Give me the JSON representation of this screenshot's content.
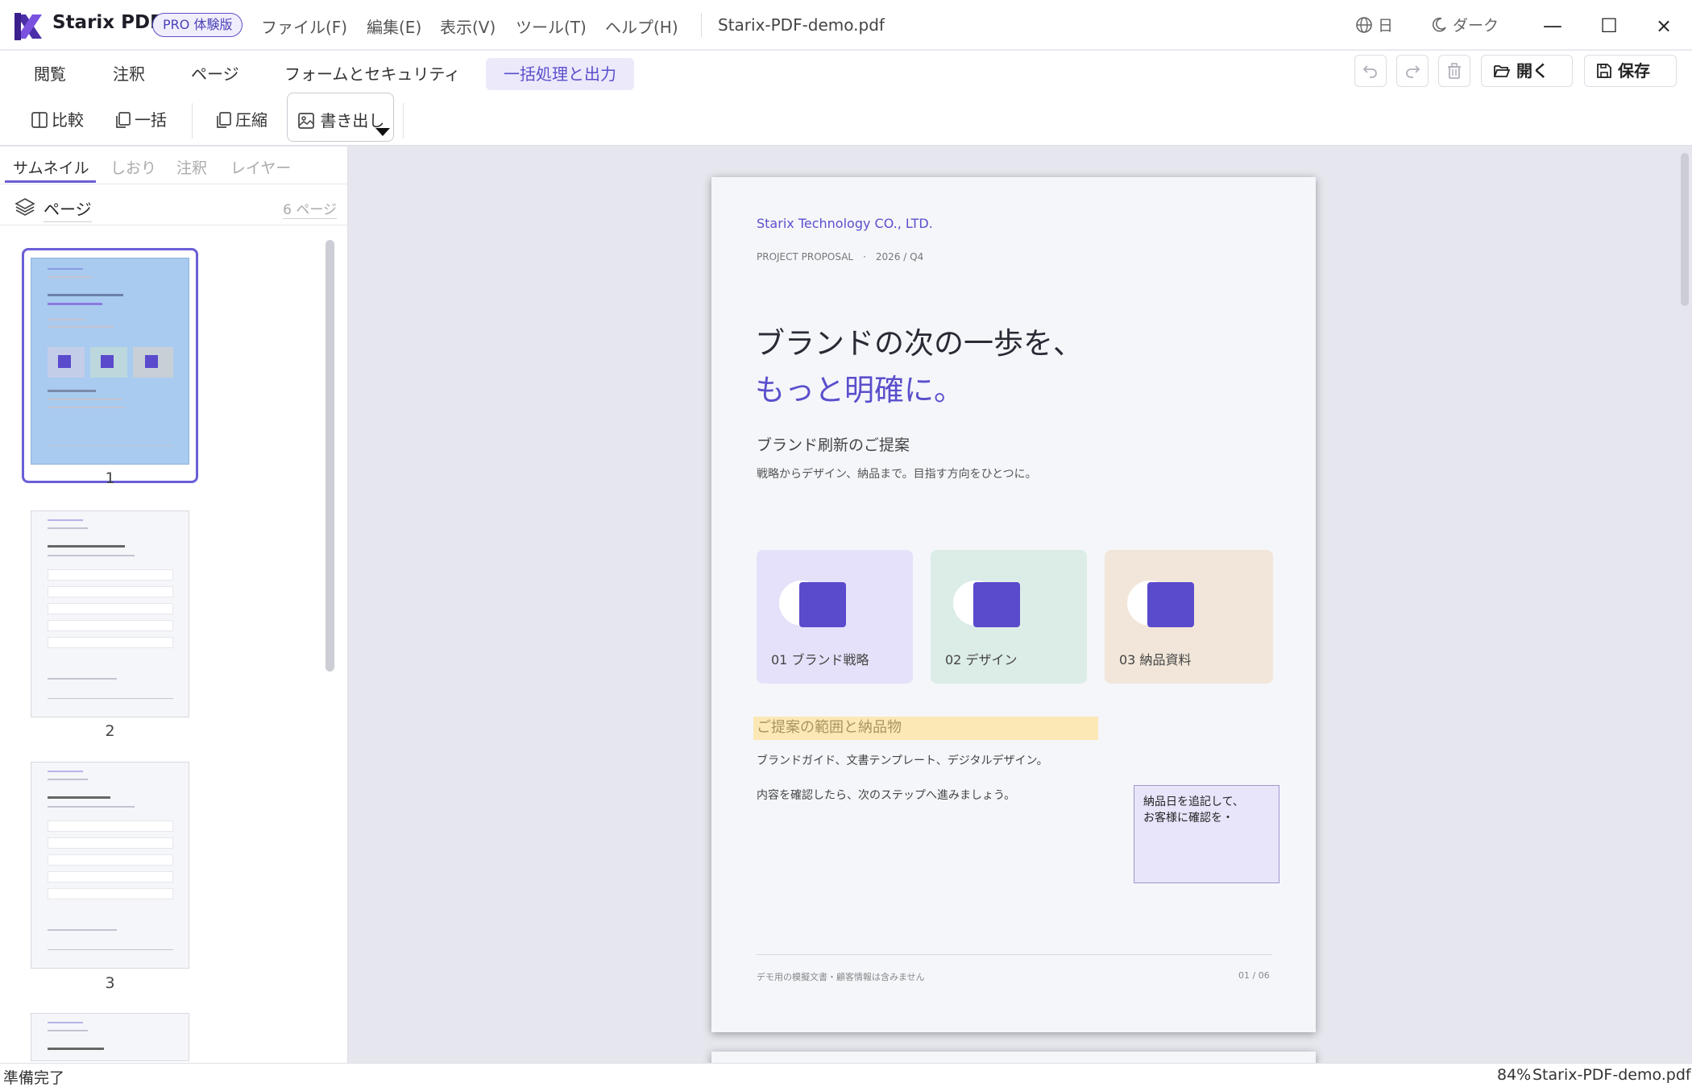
{
  "app": {
    "name": "Starix PDF",
    "badge": "PRO 体験版"
  },
  "menu": [
    "ファイル(F)",
    "編集(E)",
    "表示(V)",
    "ツール(T)",
    "ヘルプ(H)"
  ],
  "file": {
    "name": "Starix-PDF-demo.pdf"
  },
  "window": {
    "lang": "日",
    "theme": "ダーク",
    "minimize": "—",
    "maximize": "☐",
    "close": "×"
  },
  "tabs": [
    "閲覧",
    "注釈",
    "ページ",
    "フォームとセキュリティ",
    "一括処理と出力"
  ],
  "active_tab": "一括処理と出力",
  "toolbar": {
    "open": "開く",
    "save": "保存",
    "compare": "比較",
    "batch": "一括",
    "compress": "圧縮",
    "export": "書き出し"
  },
  "sidebar": {
    "tabs": [
      "サムネイル",
      "しおり",
      "注釈",
      "レイヤー"
    ],
    "pages_label": "ページ",
    "page_count": "6 ページ",
    "thumbnails": [
      {
        "num": "1"
      },
      {
        "num": "2"
      },
      {
        "num": "3"
      }
    ]
  },
  "doc": {
    "company": "Starix Technology CO., LTD.",
    "meta": "PROJECT PROPOSAL　·　2026 / Q4",
    "headline1": "ブランドの次の一歩を、",
    "headline2": "もっと明確に。",
    "subtitle": "ブランド刷新のご提案",
    "intro": "戦略からデザイン、納品まで。目指す方向をひとつに。",
    "cards": [
      {
        "label": "01  ブランド戦略",
        "bg": "#e5e1fa"
      },
      {
        "label": "02  デザイン",
        "bg": "#dcece7"
      },
      {
        "label": "03  納品資料",
        "bg": "#f1e6d9"
      }
    ],
    "section_title": "ご提案の範囲と納品物",
    "body1": "ブランドガイド、文書テンプレート、デジタルデザイン。",
    "body2": "内容を確認したら、次のステップへ進みましょう。",
    "note_line1": "納品日を追記して、",
    "note_line2": "お客様に確認を・",
    "footer_left": "デモ用の模擬文書・顧客情報は含みません",
    "footer_right": "01 / 06"
  },
  "status": {
    "left": "準備完了",
    "zoom": "84%",
    "file": "Starix-PDF-demo.pdf"
  },
  "colors": {
    "accent": "#5a4fcc",
    "highlight": "#fbe8b5",
    "note": "#e8e5fb"
  }
}
